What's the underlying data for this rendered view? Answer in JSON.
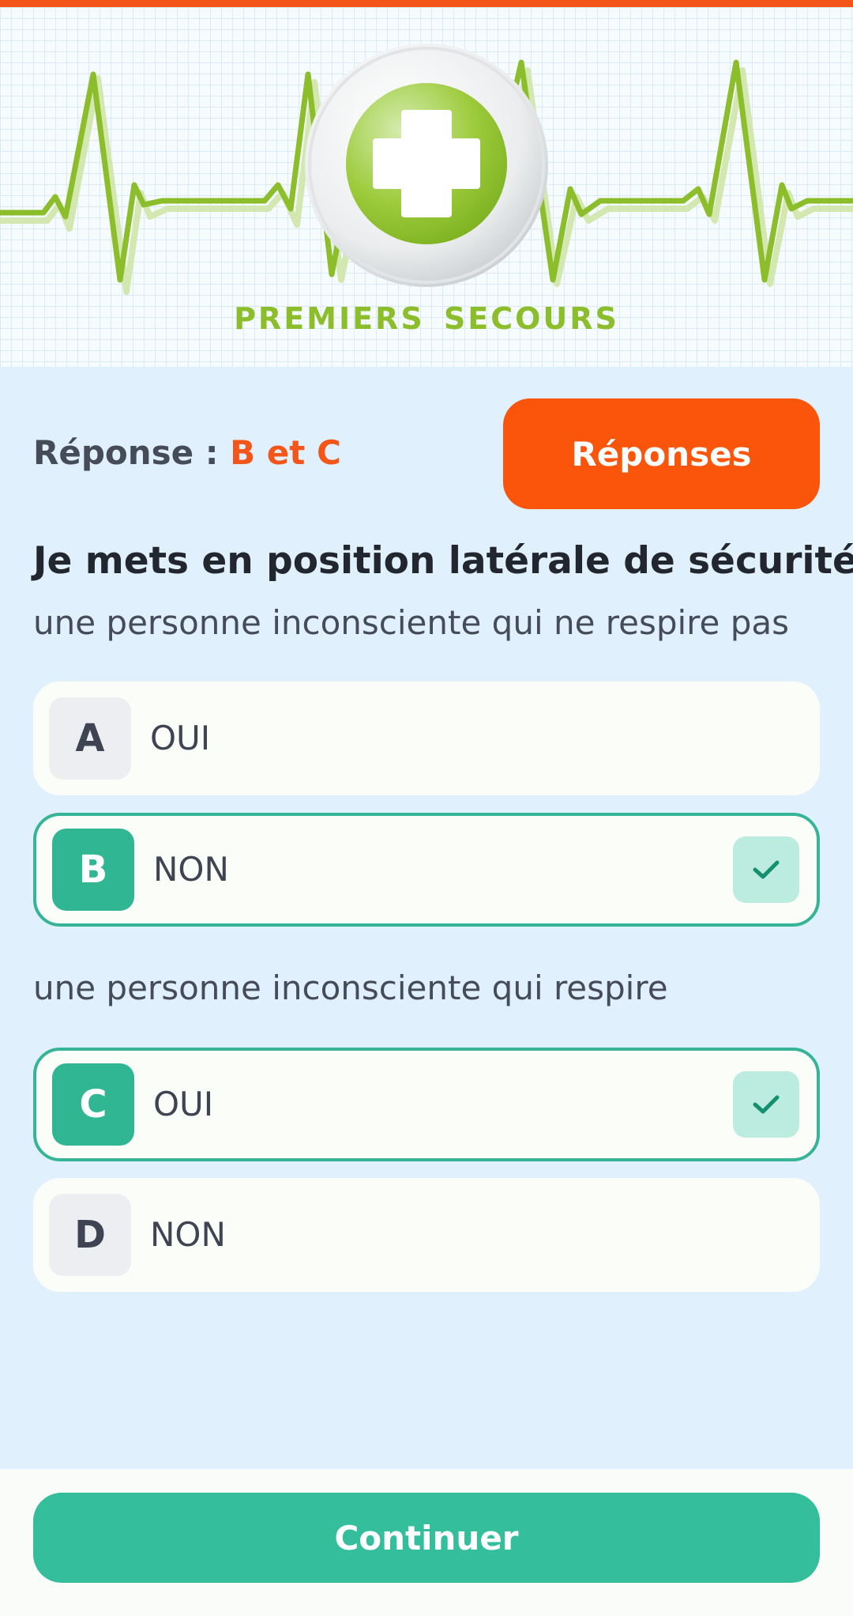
{
  "header": {
    "banner_title": "PREMIERS SECOURS",
    "logo_icon": "first-aid-cross-icon",
    "colors": {
      "accent_bar": "#f4561a",
      "ecg_line": "#8cbd2a"
    }
  },
  "answer": {
    "label": "Réponse : ",
    "value": "B et C"
  },
  "responses_button": {
    "label": "Réponses"
  },
  "question": {
    "title": "Je mets en position latérale de sécurité:",
    "groups": [
      {
        "prompt": "une personne inconsciente qui ne respire pas",
        "options": [
          {
            "letter": "A",
            "text": "OUI",
            "correct": false
          },
          {
            "letter": "B",
            "text": "NON",
            "correct": true
          }
        ]
      },
      {
        "prompt": "une personne inconsciente qui respire",
        "options": [
          {
            "letter": "C",
            "text": "OUI",
            "correct": true
          },
          {
            "letter": "D",
            "text": "NON",
            "correct": false
          }
        ]
      }
    ]
  },
  "continue_button": {
    "label": "Continuer"
  },
  "icons": {
    "correct_mark": "checkmark-icon"
  },
  "colors": {
    "primary": "#34be9c",
    "orange": "#fb550b",
    "background": "#e1f0fd"
  }
}
